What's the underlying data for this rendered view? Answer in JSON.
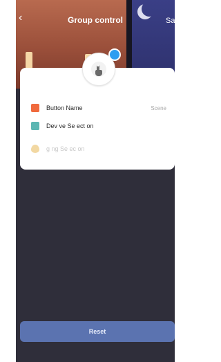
{
  "header": {
    "title": "Group control",
    "right_action_label": "Sa"
  },
  "card": {
    "rows": [
      {
        "label": "Button Name",
        "value": "Scene",
        "icon": "square-icon",
        "icon_color": "#f06a3d"
      },
      {
        "label": "Dev ve Se ect on",
        "value": "",
        "icon": "list-icon",
        "icon_color": "#5cb6b3"
      },
      {
        "label": "g   ng Se ec  on",
        "value": "",
        "icon": "drop-icon",
        "icon_color": "#f2d8a2"
      }
    ]
  },
  "footer": {
    "reset_label": "Reset"
  },
  "colors": {
    "screen_bg": "#2f2e3a",
    "accent_blue": "#2f9df0",
    "reset_bg": "#5b73b0"
  }
}
